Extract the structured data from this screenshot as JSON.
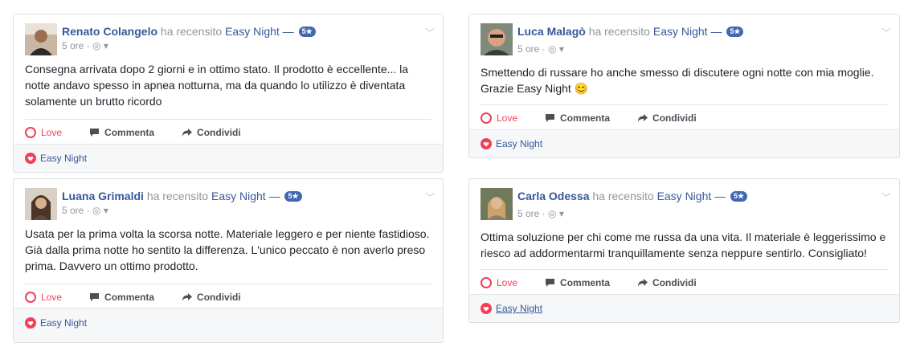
{
  "common": {
    "verb": "ha recensito",
    "page": "Easy Night",
    "dash": "—",
    "badge": "5★",
    "meta": "5 ore ·",
    "love": "Love",
    "comment": "Commenta",
    "share": "Condividi",
    "reaction_page": "Easy Night"
  },
  "colors": {
    "link": "#365899",
    "love": "#f33e58",
    "badge": "#4267b2",
    "footer_bg": "#f6f7f9"
  },
  "reviews": [
    {
      "name": "Renato Colangelo",
      "text": "Consegna arrivata dopo 2 giorni e in ottimo stato. Il prodotto è eccellente... la notte andavo spesso in apnea notturna, ma da quando lo utilizzo è diventata solamente un brutto ricordo"
    },
    {
      "name": "Luca Malagò",
      "text": "Smettendo di russare ho anche smesso di discutere ogni notte con mia moglie. Grazie Easy Night 😊"
    },
    {
      "name": "Luana Grimaldi",
      "text": "Usata per la prima volta la scorsa notte. Materiale leggero e per niente fastidioso. Già dalla prima notte ho sentito la differenza. L'unico peccato è non averlo preso prima. Davvero un ottimo prodotto."
    },
    {
      "name": "Carla Odessa",
      "text": "Ottima soluzione per chi come me russa da una vita. Il materiale è leggerissimo e riesco ad addormentarmi tranquillamente senza neppure sentirlo. Consigliato!"
    }
  ]
}
